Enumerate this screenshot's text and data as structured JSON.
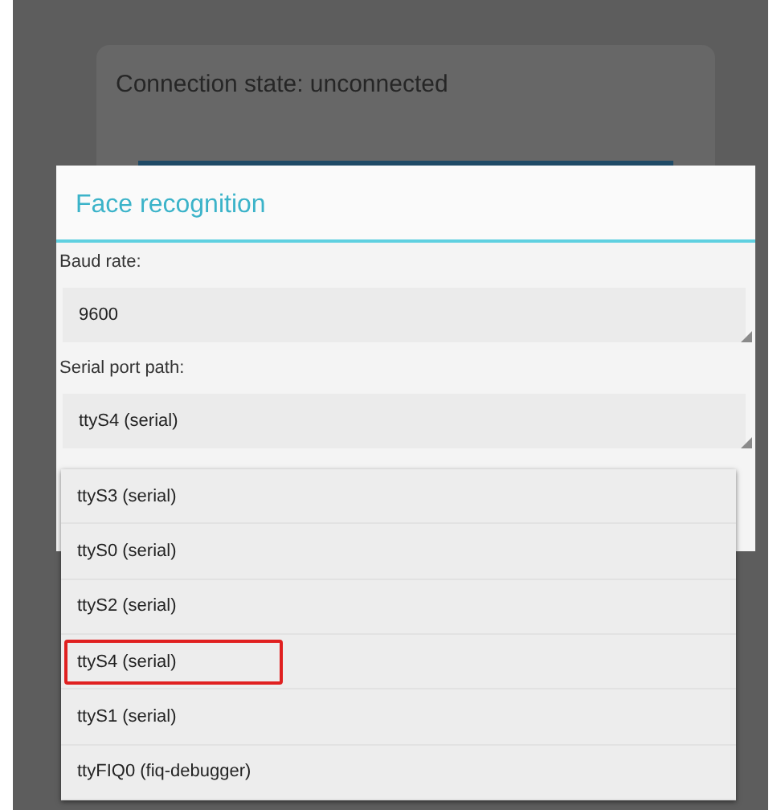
{
  "background": {
    "status": "Connection state: unconnected"
  },
  "dialog": {
    "title": "Face recognition",
    "fields": [
      {
        "label": "Baud rate:",
        "value": "9600"
      },
      {
        "label": "Serial port path:",
        "value": "ttyS4 (serial)"
      }
    ]
  },
  "dropdown": {
    "items": [
      {
        "label": "ttyS3 (serial)",
        "highlighted": false
      },
      {
        "label": "ttyS0 (serial)",
        "highlighted": false
      },
      {
        "label": "ttyS2 (serial)",
        "highlighted": false
      },
      {
        "label": "ttyS4 (serial)",
        "highlighted": true
      },
      {
        "label": "ttyS1 (serial)",
        "highlighted": false
      },
      {
        "label": "ttyFIQ0 (fiq-debugger)",
        "highlighted": false
      }
    ]
  }
}
